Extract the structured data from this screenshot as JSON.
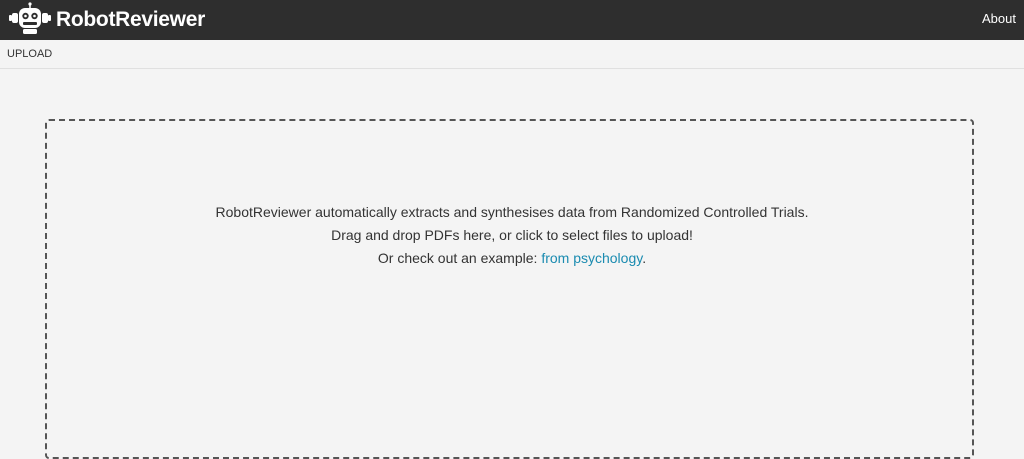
{
  "header": {
    "brand": "RobotReviewer",
    "logo_icon": "robot-logo-icon",
    "about_label": "About"
  },
  "breadcrumb": {
    "label": "UPLOAD"
  },
  "dropzone": {
    "line1": "RobotReviewer automatically extracts and synthesises data from Randomized Controlled Trials.",
    "line2": "Drag and drop PDFs here, or click to select files to upload!",
    "line3_prefix": "Or check out an example: ",
    "example_link": "from psychology",
    "line3_suffix": "."
  },
  "colors": {
    "header_bg": "#2e2e2e",
    "page_bg": "#f4f4f4",
    "link": "#1a8bb0"
  }
}
